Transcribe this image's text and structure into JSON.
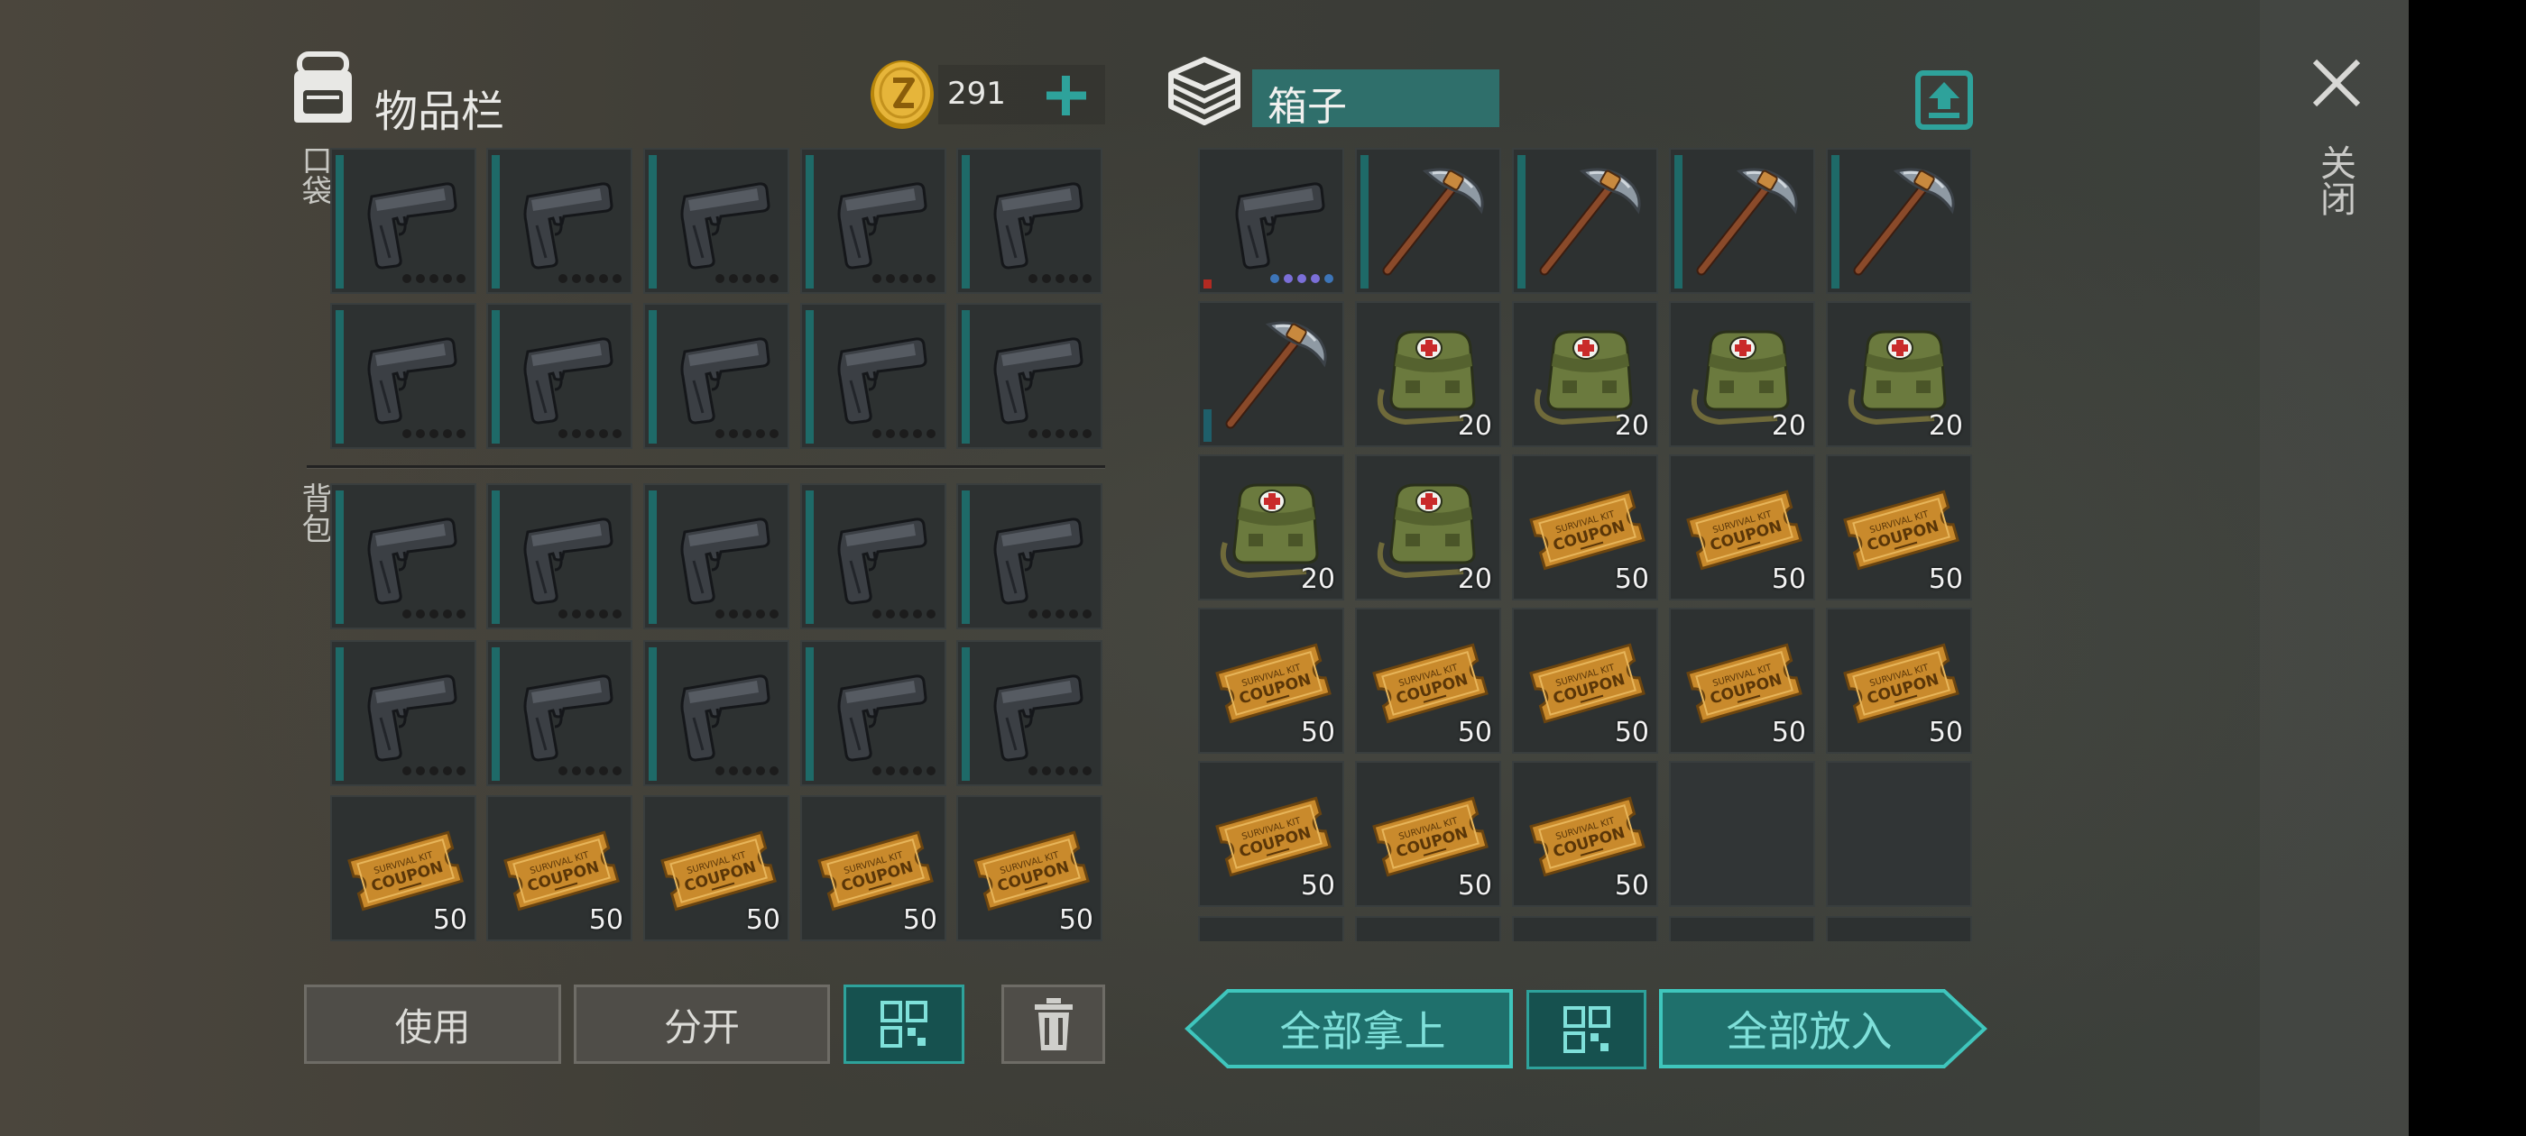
{
  "inventory": {
    "title": "物品栏",
    "coins": "291",
    "pocket_label": "口袋",
    "backpack_label": "背包",
    "pocket_slots": [
      {
        "item": "pistol",
        "dots": 5
      },
      {
        "item": "pistol",
        "dots": 5
      },
      {
        "item": "pistol",
        "dots": 5
      },
      {
        "item": "pistol",
        "dots": 5
      },
      {
        "item": "pistol",
        "dots": 5
      },
      {
        "item": "pistol",
        "dots": 5
      },
      {
        "item": "pistol",
        "dots": 5
      },
      {
        "item": "pistol",
        "dots": 5
      },
      {
        "item": "pistol",
        "dots": 5
      },
      {
        "item": "pistol",
        "dots": 5
      }
    ],
    "backpack_slots": [
      {
        "item": "pistol",
        "dots": 5
      },
      {
        "item": "pistol",
        "dots": 5
      },
      {
        "item": "pistol",
        "dots": 5
      },
      {
        "item": "pistol",
        "dots": 5
      },
      {
        "item": "pistol",
        "dots": 5
      },
      {
        "item": "pistol",
        "dots": 5
      },
      {
        "item": "pistol",
        "dots": 5
      },
      {
        "item": "pistol",
        "dots": 5
      },
      {
        "item": "pistol",
        "dots": 5
      },
      {
        "item": "pistol",
        "dots": 5
      },
      {
        "item": "coupon",
        "qty": "50"
      },
      {
        "item": "coupon",
        "qty": "50"
      },
      {
        "item": "coupon",
        "qty": "50"
      },
      {
        "item": "coupon",
        "qty": "50"
      },
      {
        "item": "coupon",
        "qty": "50"
      }
    ],
    "buttons": {
      "use": "使用",
      "split": "分开"
    }
  },
  "box": {
    "title": "箱子",
    "slots": [
      {
        "item": "pistol",
        "dots": 5,
        "colored_dots": true,
        "bar": "red"
      },
      {
        "item": "pickaxe",
        "bar": "full"
      },
      {
        "item": "pickaxe",
        "bar": "full"
      },
      {
        "item": "pickaxe",
        "bar": "full"
      },
      {
        "item": "pickaxe",
        "bar": "full"
      },
      {
        "item": "pickaxe",
        "bar": "short"
      },
      {
        "item": "medkit",
        "qty": "20"
      },
      {
        "item": "medkit",
        "qty": "20"
      },
      {
        "item": "medkit",
        "qty": "20"
      },
      {
        "item": "medkit",
        "qty": "20"
      },
      {
        "item": "medkit",
        "qty": "20"
      },
      {
        "item": "medkit",
        "qty": "20"
      },
      {
        "item": "coupon",
        "qty": "50"
      },
      {
        "item": "coupon",
        "qty": "50"
      },
      {
        "item": "coupon",
        "qty": "50"
      },
      {
        "item": "coupon",
        "qty": "50"
      },
      {
        "item": "coupon",
        "qty": "50"
      },
      {
        "item": "coupon",
        "qty": "50"
      },
      {
        "item": "coupon",
        "qty": "50"
      },
      {
        "item": "coupon",
        "qty": "50"
      },
      {
        "item": "coupon",
        "qty": "50"
      },
      {
        "item": "coupon",
        "qty": "50"
      },
      {
        "item": "coupon",
        "qty": "50"
      },
      {
        "item": "empty"
      },
      {
        "item": "empty"
      }
    ],
    "buttons": {
      "take_all": "全部拿上",
      "put_all": "全部放入"
    }
  },
  "close_label": "关闭",
  "coupon_text": {
    "line1": "SURVIVAL KIT",
    "line2": "COUPON"
  },
  "icons": [
    "backpack-icon",
    "coin-icon",
    "plus-icon",
    "box-icon",
    "export-icon",
    "close-icon",
    "grid-icon",
    "trash-icon"
  ],
  "colors": {
    "accent": "#2ea29b",
    "bar": "#1e6a68",
    "box_name_bg": "#2f6f6b"
  }
}
